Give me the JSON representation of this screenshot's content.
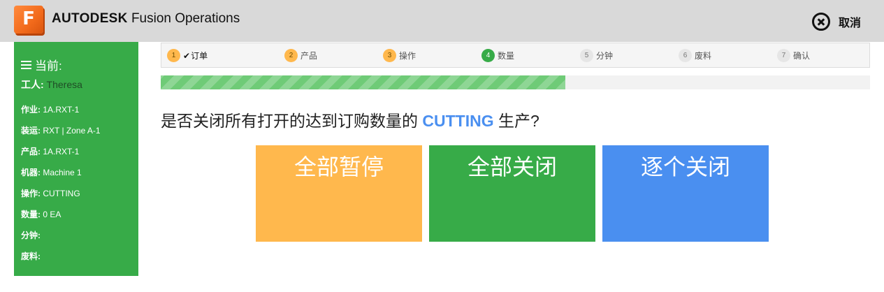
{
  "header": {
    "logo_letter": "F",
    "brand_bold": "AUTODESK",
    "brand_rest": " Fusion Operations",
    "cancel_label": "取消"
  },
  "sidebar": {
    "title": "当前:",
    "worker_label": "工人:",
    "worker_value": " Theresa",
    "rows": [
      {
        "key": "作业:",
        "value": " 1A.RXT-1"
      },
      {
        "key": "装运:",
        "value": " RXT | Zone A-1"
      },
      {
        "key": "产品:",
        "value": " 1A.RXT-1"
      },
      {
        "key": "机器:",
        "value": " Machine 1"
      },
      {
        "key": "操作:",
        "value": " CUTTING"
      },
      {
        "key": "数量:",
        "value": " 0 EA"
      },
      {
        "key": "分钟:",
        "value": ""
      },
      {
        "key": "废料:",
        "value": ""
      }
    ]
  },
  "steps": [
    {
      "num": "1",
      "label": "订单",
      "check": "✔",
      "state": "orange"
    },
    {
      "num": "2",
      "label": "产品",
      "state": "orange"
    },
    {
      "num": "3",
      "label": "操作",
      "state": "orange"
    },
    {
      "num": "4",
      "label": "数量",
      "state": "green"
    },
    {
      "num": "5",
      "label": "分钟",
      "state": "gray"
    },
    {
      "num": "6",
      "label": "废料",
      "state": "gray"
    },
    {
      "num": "7",
      "label": "确认",
      "state": "gray"
    }
  ],
  "progress": {
    "fraction": 0.57
  },
  "question": {
    "before": "是否关闭所有打开的达到订购数量的 ",
    "highlight": "CUTTING",
    "after": " 生产?"
  },
  "actions": {
    "pause_all": "全部暂停",
    "close_all": "全部关闭",
    "close_each": "逐个关闭"
  },
  "colors": {
    "orange": "#ffb84d",
    "green": "#37ab48",
    "blue": "#4a8ff0",
    "header_bg": "#d9d9d9"
  }
}
